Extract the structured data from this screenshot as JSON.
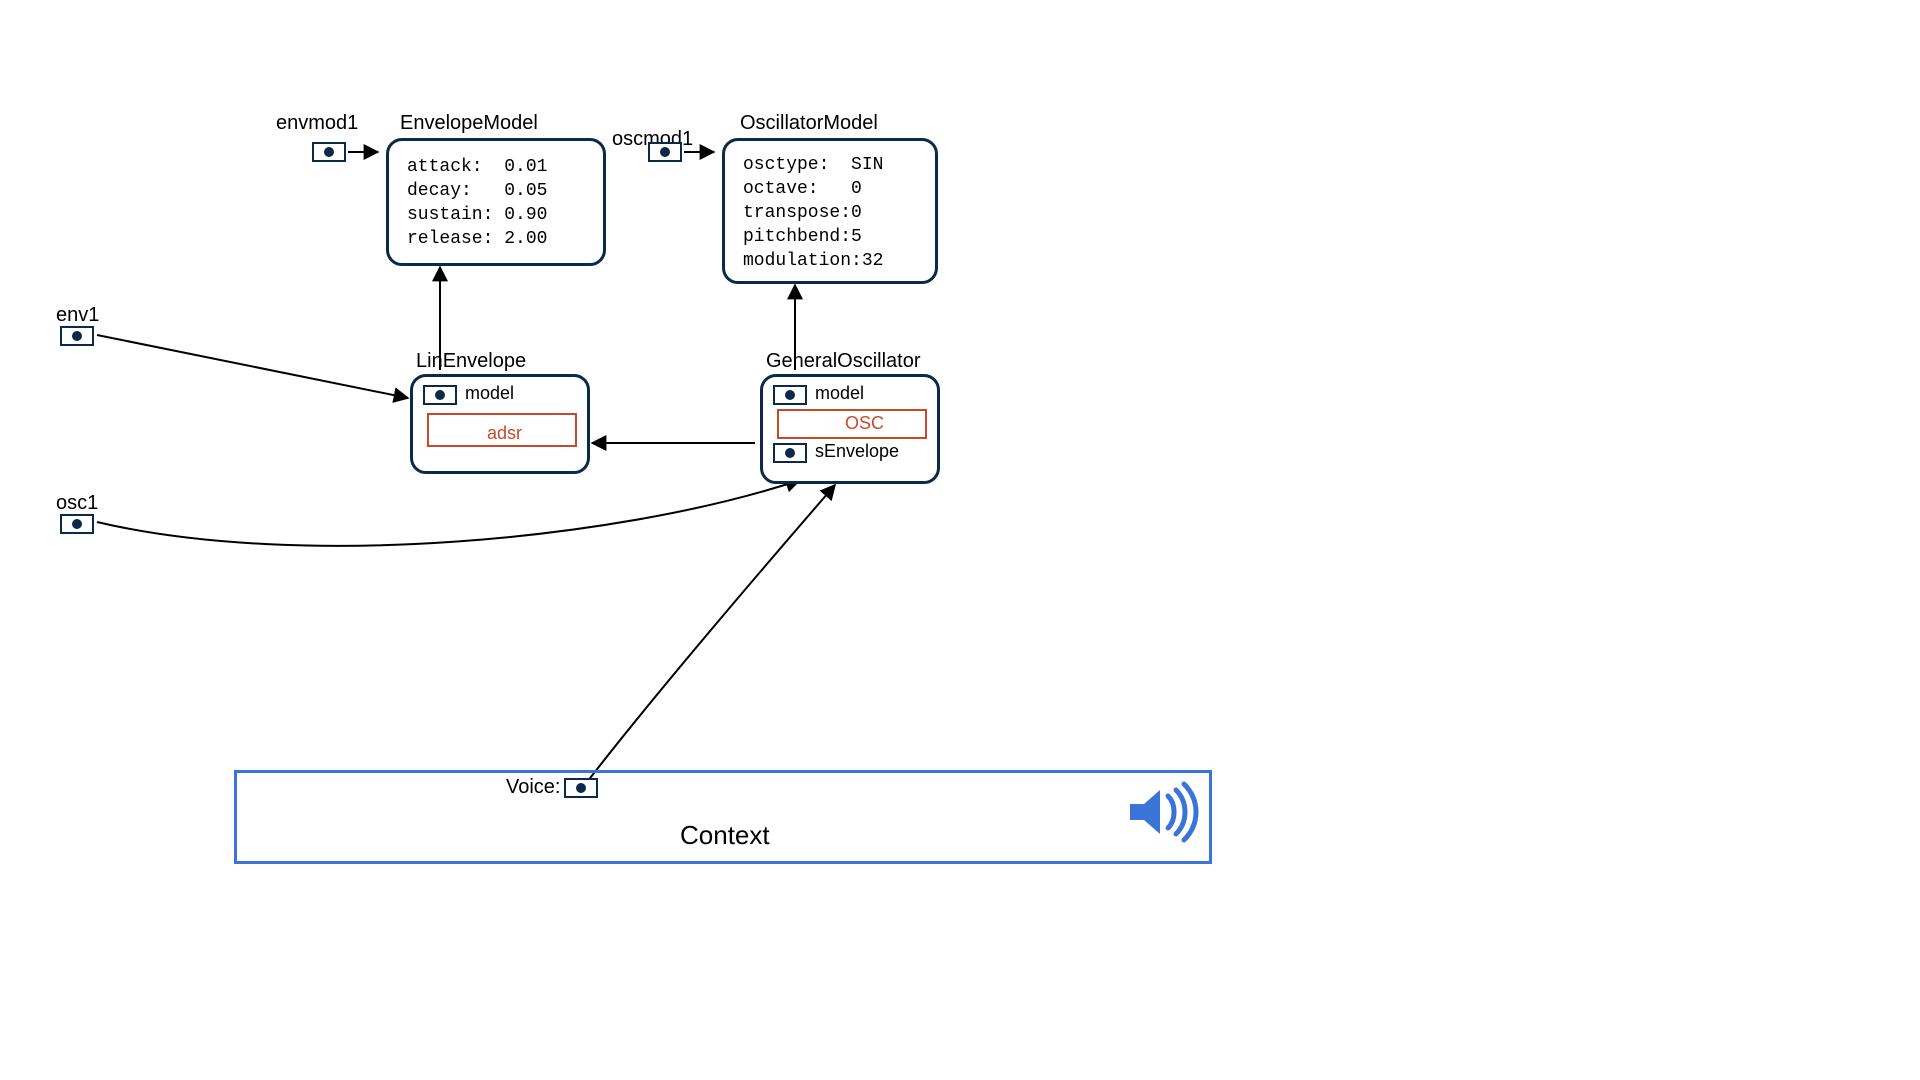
{
  "colors": {
    "node_border": "#0b2a4a",
    "accent_red": "#c84a2c",
    "context_blue": "#3a74d8"
  },
  "ports": {
    "envmod1": {
      "label": "envmod1"
    },
    "env1": {
      "label": "env1"
    },
    "osc1": {
      "label": "osc1"
    },
    "oscmod1": {
      "label": "oscmod1"
    },
    "voice": {
      "label": "Voice:"
    }
  },
  "nodes": {
    "envelope_model": {
      "title": "EnvelopeModel",
      "lines": [
        "attack:  0.01",
        "decay:   0.05",
        "sustain: 0.90",
        "release: 2.00"
      ],
      "data": {
        "attack": 0.01,
        "decay": 0.05,
        "sustain": 0.9,
        "release": 2.0
      }
    },
    "oscillator_model": {
      "title": "OscillatorModel",
      "lines": [
        "osctype:  SIN",
        "octave:   0",
        "transpose:0",
        "pitchbend:5",
        "modulation:32"
      ],
      "data": {
        "osctype": "SIN",
        "octave": 0,
        "transpose": 0,
        "pitchbend": 5,
        "modulation": 32
      }
    },
    "lin_envelope": {
      "title": "LinEnvelope",
      "port_label": "model",
      "wave_label": "adsr"
    },
    "general_oscillator": {
      "title": "GeneralOscillator",
      "port_model_label": "model",
      "port_env_label": "sEnvelope",
      "wave_label": "OSC"
    }
  },
  "context": {
    "title": "Context"
  }
}
